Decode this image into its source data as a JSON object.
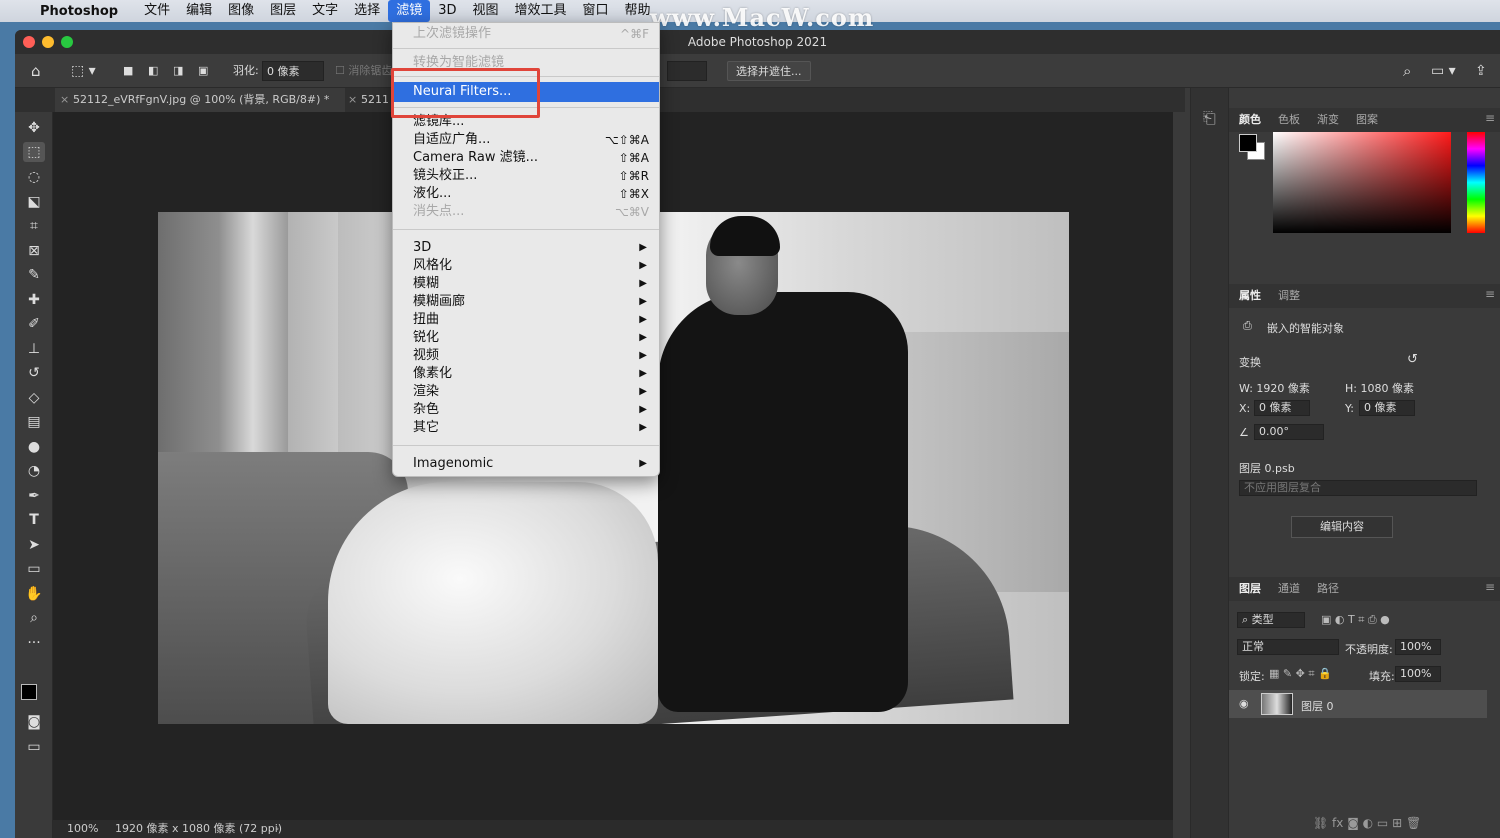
{
  "menubar": {
    "app": "Photoshop",
    "items": [
      "文件",
      "编辑",
      "图像",
      "图层",
      "文字",
      "选择",
      "滤镜",
      "3D",
      "视图",
      "增效工具",
      "窗口",
      "帮助"
    ],
    "active": "滤镜"
  },
  "watermark": "www.MacW.com",
  "window": {
    "title": "Adobe Photoshop 2021"
  },
  "options": {
    "feather_label": "羽化:",
    "feather_value": "0 像素",
    "antialias_label": "消除锯齿",
    "select_mask_button": "选择并遮住..."
  },
  "tabs": [
    {
      "label": "52112_eVRfFgnV.jpg @ 100% (背景, RGB/8#) *"
    },
    {
      "label": "5211"
    }
  ],
  "filter_menu": {
    "last_filter": "上次滤镜操作",
    "last_filter_shortcut": "^⌘F",
    "convert_smart": "转换为智能滤镜",
    "neural_filters": "Neural Filters...",
    "group1": [
      {
        "label": "滤镜库...",
        "shortcut": ""
      },
      {
        "label": "自适应广角...",
        "shortcut": "⌥⇧⌘A"
      },
      {
        "label": "Camera Raw 滤镜...",
        "shortcut": "⇧⌘A"
      },
      {
        "label": "镜头校正...",
        "shortcut": "⇧⌘R"
      },
      {
        "label": "液化...",
        "shortcut": "⇧⌘X"
      },
      {
        "label": "消失点...",
        "shortcut": "⌥⌘V",
        "disabled": true
      }
    ],
    "submenus": [
      "3D",
      "风格化",
      "模糊",
      "模糊画廊",
      "扭曲",
      "锐化",
      "视频",
      "像素化",
      "渲染",
      "杂色",
      "其它"
    ],
    "plugins": [
      "Imagenomic"
    ]
  },
  "color_panel": {
    "tabs": [
      "颜色",
      "色板",
      "渐变",
      "图案"
    ],
    "foreground": "#000000",
    "background": "#ffffff"
  },
  "properties_panel": {
    "tabs": [
      "属性",
      "调整"
    ],
    "object_type": "嵌入的智能对象",
    "transform_label": "变换",
    "w": "W: 1920 像素",
    "h": "H: 1080 像素",
    "x_label": "X:",
    "x_value": "0 像素",
    "y_label": "Y:",
    "y_value": "0 像素",
    "angle": "0.00°",
    "file": "图层 0.psb",
    "comp_placeholder": "不应用图层复合",
    "edit_button": "编辑内容"
  },
  "layers_panel": {
    "tabs": [
      "图层",
      "通道",
      "路径"
    ],
    "filter_kind": "类型",
    "blend_mode": "正常",
    "opacity_label": "不透明度:",
    "opacity": "100%",
    "lock_label": "锁定:",
    "fill_label": "填充:",
    "fill": "100%",
    "layers": [
      {
        "name": "图层 0"
      }
    ]
  },
  "status": {
    "zoom": "100%",
    "info": "1920 像素 x 1080 像素 (72 ppi)"
  }
}
